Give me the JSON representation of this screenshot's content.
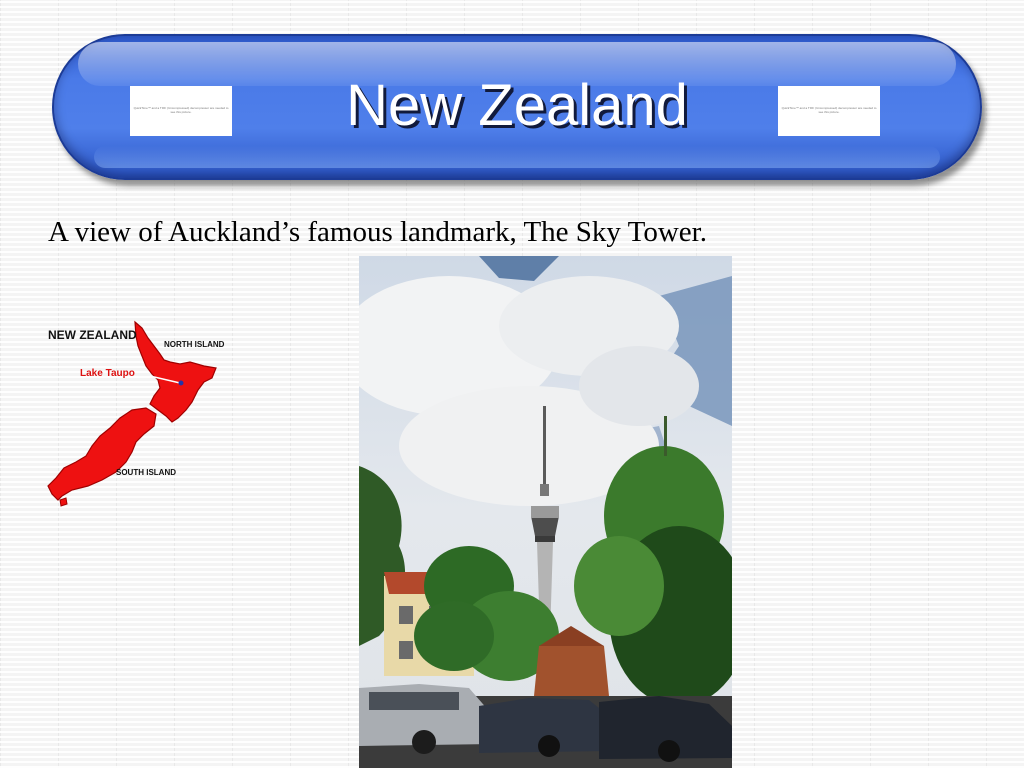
{
  "title": "New Zealand",
  "quicktime_placeholder": "QuickTime™ and a TIFF (Uncompressed) decompressor are needed to see this picture.",
  "caption": "A view of Auckland’s famous landmark, The Sky Tower.",
  "map": {
    "country_label": "NEW ZEALAND",
    "north_island_label": "NORTH ISLAND",
    "lake_label": "Lake Taupo",
    "south_island_label": "SOUTH ISLAND",
    "land_color": "#ee1111",
    "lake_label_color": "#dd1111"
  },
  "colors": {
    "banner_blue": "#4a7ae8",
    "title_text": "#ffffff"
  },
  "photo": {
    "subject": "sky-tower-photo"
  }
}
